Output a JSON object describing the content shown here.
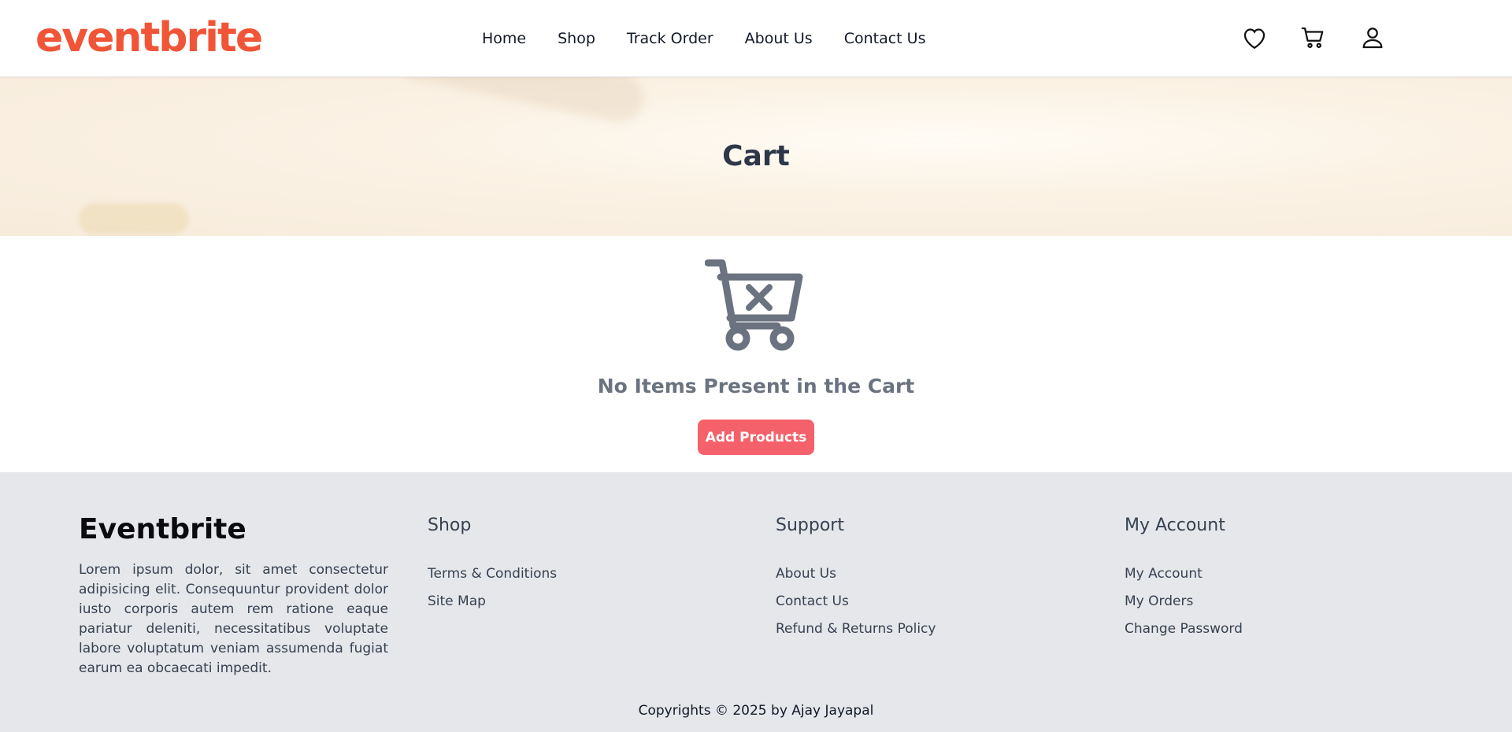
{
  "header": {
    "logo": "eventbrite",
    "nav": [
      "Home",
      "Shop",
      "Track Order",
      "About Us",
      "Contact Us"
    ],
    "icons": [
      "heart-icon",
      "cart-icon",
      "user-icon"
    ]
  },
  "banner": {
    "title": "Cart"
  },
  "empty_cart": {
    "icon": "cart-remove-icon",
    "message": "No Items Present in the Cart",
    "button_label": "Add Products"
  },
  "footer": {
    "brand": {
      "title": "Eventbrite",
      "text": "Lorem ipsum dolor, sit amet consectetur adipisicing elit. Consequuntur provident dolor iusto corporis autem rem ratione eaque pariatur deleniti, necessitatibus voluptate labore voluptatum veniam assumenda fugiat earum ea obcaecati impedit."
    },
    "columns": [
      {
        "heading": "Shop",
        "links": [
          "Terms & Conditions",
          "Site Map"
        ]
      },
      {
        "heading": "Support",
        "links": [
          "About Us",
          "Contact Us",
          "Refund & Returns Policy"
        ]
      },
      {
        "heading": "My Account",
        "links": [
          "My Account",
          "My Orders",
          "Change Password"
        ]
      }
    ],
    "copyright": "Copyrights © 2025 by Ajay Jayapal"
  },
  "colors": {
    "brand": "#f05537",
    "button": "#f5616a",
    "footer_bg": "#e5e7eb",
    "icon_gray": "#6b7280"
  }
}
